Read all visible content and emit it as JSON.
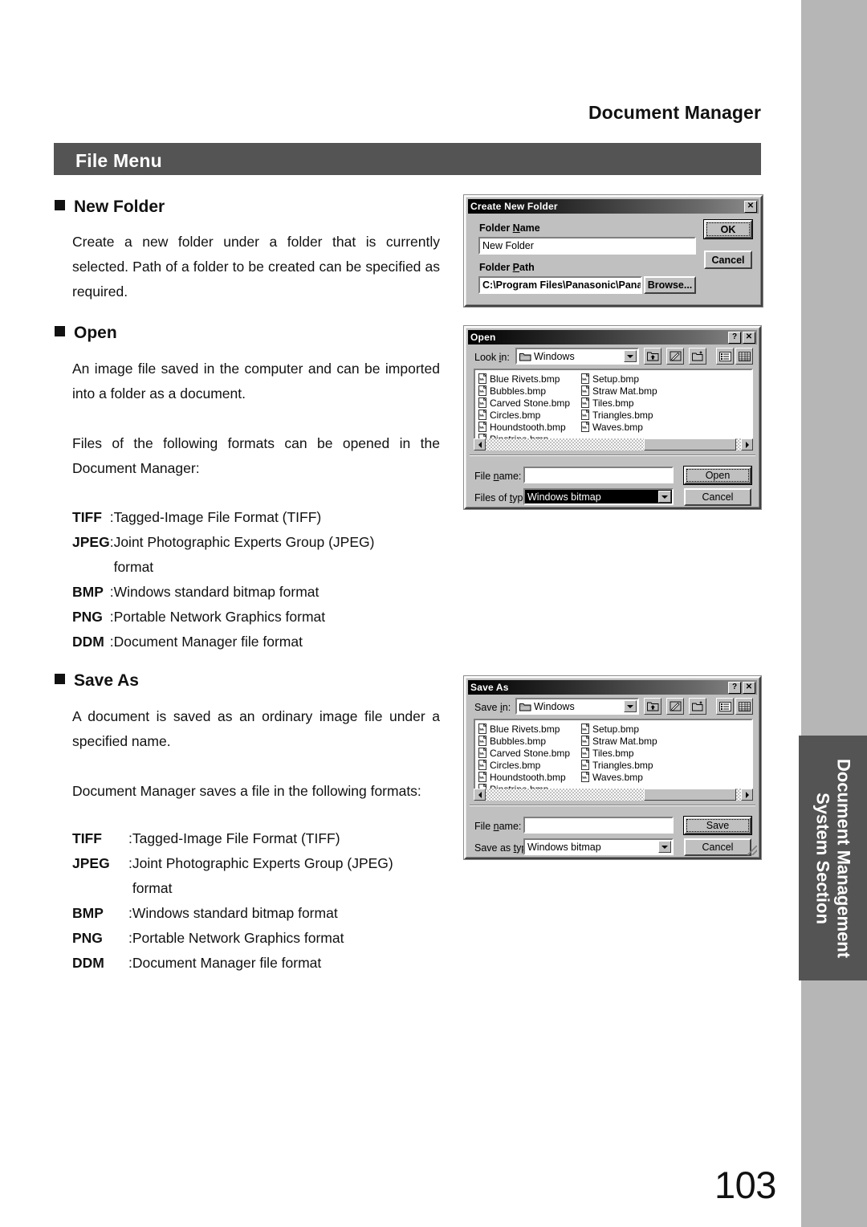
{
  "page": {
    "running_head": "Document Manager",
    "section_title": "File Menu",
    "page_number": "103",
    "side_tab_line1": "Document Management",
    "side_tab_line2": "System Section",
    "colors": {
      "bar_gray": "#545454",
      "edge_band_gray": "#b6b6b6",
      "dialog_face": "#c0c0c0"
    }
  },
  "sections": {
    "new_folder": {
      "heading": "New Folder",
      "paragraph": "Create a new folder under a folder that is currently selected.  Path of a folder to be created can be specified as required."
    },
    "open": {
      "heading": "Open",
      "paragraph1": "An image file saved in the computer and can be imported into a folder as a document.",
      "paragraph2": "Files of the following formats can be opened in the Document Manager:",
      "formats": [
        {
          "key": "TIFF",
          "colon": ":",
          "desc": "Tagged-Image File Format (TIFF)",
          "cont": ""
        },
        {
          "key": "JPEG",
          "colon": ":",
          "desc": "Joint Photographic Experts Group (JPEG)",
          "cont": "format"
        },
        {
          "key": "BMP",
          "colon": ":",
          "desc": "Windows standard bitmap format",
          "cont": ""
        },
        {
          "key": "PNG",
          "colon": ":",
          "desc": "Portable Network Graphics format",
          "cont": ""
        },
        {
          "key": "DDM",
          "colon": ":",
          "desc": "Document Manager file format",
          "cont": ""
        }
      ]
    },
    "save_as": {
      "heading": "Save As",
      "paragraph1": "A document is saved as an ordinary image file under a specified name.",
      "paragraph2": "Document Manager saves a file in the following formats:",
      "formats": [
        {
          "key": "TIFF",
          "colon": ":",
          "desc": "Tagged-Image File Format (TIFF)",
          "cont": ""
        },
        {
          "key": "JPEG",
          "colon": ":",
          "desc": "Joint Photographic Experts Group (JPEG)",
          "cont": "format"
        },
        {
          "key": "BMP",
          "colon": ":",
          "desc": "Windows standard bitmap format",
          "cont": ""
        },
        {
          "key": "PNG",
          "colon": ":",
          "desc": "Portable Network Graphics format",
          "cont": ""
        },
        {
          "key": "DDM",
          "colon": ":",
          "desc": "Document Manager file format",
          "cont": ""
        }
      ]
    }
  },
  "dialogs": {
    "create_new_folder": {
      "title": "Create New Folder",
      "close_label": "✕",
      "folder_name_label": "Folder Name",
      "folder_name_value": "New Folder",
      "folder_path_label": "Folder Path",
      "folder_path_value": "C:\\Program Files\\Panasonic\\Panasonic-D",
      "browse_label": "Browse...",
      "ok_label": "OK",
      "cancel_label": "Cancel"
    },
    "open": {
      "title": "Open",
      "help_label": "?",
      "close_label": "✕",
      "lookin_label": "Look in:",
      "lookin_value": "Windows",
      "files_col1": [
        "Blue Rivets.bmp",
        "Bubbles.bmp",
        "Carved Stone.bmp",
        "Circles.bmp",
        "Houndstooth.bmp",
        "Pinstripe.bmp"
      ],
      "files_col2": [
        "Setup.bmp",
        "Straw Mat.bmp",
        "Tiles.bmp",
        "Triangles.bmp",
        "Waves.bmp"
      ],
      "filename_label": "File name:",
      "filename_value": "",
      "filetype_label": "Files of type:",
      "filetype_value": "Windows bitmap",
      "open_label": "Open",
      "cancel_label": "Cancel"
    },
    "save_as": {
      "title": "Save As",
      "help_label": "?",
      "close_label": "✕",
      "savein_label": "Save in:",
      "savein_value": "Windows",
      "files_col1": [
        "Blue Rivets.bmp",
        "Bubbles.bmp",
        "Carved Stone.bmp",
        "Circles.bmp",
        "Houndstooth.bmp",
        "Pinstripe.bmp"
      ],
      "files_col2": [
        "Setup.bmp",
        "Straw Mat.bmp",
        "Tiles.bmp",
        "Triangles.bmp",
        "Waves.bmp"
      ],
      "filename_label": "File name:",
      "filename_value": "",
      "filetype_label": "Save as type:",
      "filetype_value": "Windows bitmap",
      "save_label": "Save",
      "cancel_label": "Cancel"
    }
  }
}
